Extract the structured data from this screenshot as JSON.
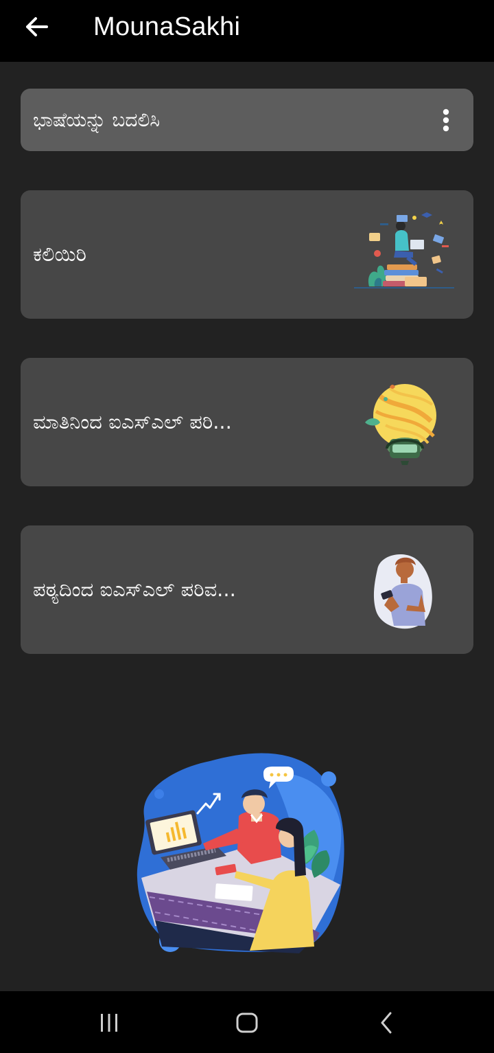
{
  "app_bar": {
    "title": "MounaSakhi",
    "back_icon": "arrow-left-icon"
  },
  "language_bar": {
    "label": "ಭಾಷೆಯನ್ನು ಬದಲಿಸಿ",
    "menu_icon": "more-vertical-icon"
  },
  "cards": [
    {
      "label": "ಕಲಿಯಿರಿ",
      "illustration": "student-studying-illustration"
    },
    {
      "label": "ಮಾತಿನಿಂದ ಐಎಸ್ಎಲ್ ಪರಿ...",
      "illustration": "speech-to-sign-illustration"
    },
    {
      "label": "ಪಠ್ಯದಿಂದ ಐಎಸ್ಎಲ್ ಪರಿವ...",
      "illustration": "text-to-sign-illustration"
    }
  ],
  "footer_illustration": "team-meeting-illustration",
  "system_nav": {
    "recents_icon": "recent-apps-icon",
    "home_icon": "home-icon",
    "back_icon": "back-chevron-icon"
  },
  "colors": {
    "background": "#222222",
    "app_bar": "#000000",
    "language_bar": "#5d5d5d",
    "card": "#474747",
    "text": "#ffffff"
  }
}
